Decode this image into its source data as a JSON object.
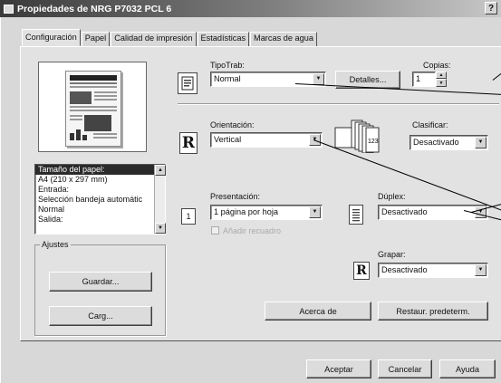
{
  "window": {
    "title": "Propiedades de NRG P7032 PCL 6",
    "help": "?"
  },
  "tabs": [
    "Configuración",
    "Papel",
    "Calidad de impresión",
    "Estadísticas",
    "Marcas de agua"
  ],
  "summary_list": [
    {
      "text": "Tamaño del papel:",
      "selected": true
    },
    {
      "text": "A4 (210 x 297 mm)",
      "selected": false
    },
    {
      "text": "Entrada:",
      "selected": false
    },
    {
      "text": "Selección bandeja automátic",
      "selected": false
    },
    {
      "text": "Normal",
      "selected": false
    },
    {
      "text": "Salida:",
      "selected": false
    }
  ],
  "ajustes": {
    "label": "Ajustes",
    "save": "Guardar...",
    "load": "Carg..."
  },
  "job": {
    "label": "TipoTrab:",
    "value": "Normal",
    "details_button": "Detalles..."
  },
  "copies": {
    "label": "Copias:",
    "value": "1"
  },
  "orientation": {
    "label": "Orientación:",
    "value": "Vertical",
    "icon_letter": "R"
  },
  "collate": {
    "label": "Clasificar:",
    "value": "Desactivado"
  },
  "layout": {
    "label": "Presentación:",
    "value": "1 página por hoja",
    "border_checkbox": "Añadir recuadro",
    "icon_number": "1"
  },
  "duplex": {
    "label": "Dúplex:",
    "value": "Desactivado"
  },
  "staple": {
    "label": "Grapar:",
    "value": "Desactivado",
    "icon_letter": "R"
  },
  "actions": {
    "about": "Acerca de",
    "restore": "Restaur. predeterm."
  },
  "footer": {
    "ok": "Aceptar",
    "cancel": "Cancelar",
    "help": "Ayuda"
  }
}
